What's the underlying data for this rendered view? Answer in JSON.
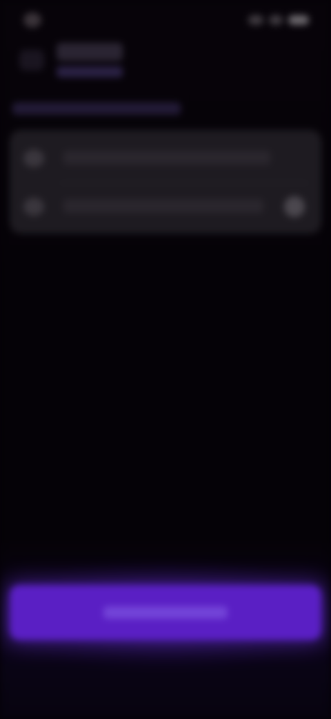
{
  "status_bar": {
    "icons": [
      "signal-icon",
      "wifi-icon",
      "battery-icon"
    ]
  },
  "header": {
    "back_icon": "back-arrow-icon",
    "title": "",
    "subtitle": ""
  },
  "section": {
    "label": ""
  },
  "card": {
    "rows": [
      {
        "icon": "avatar-icon",
        "text": "",
        "trailing": ""
      },
      {
        "icon": "item-icon",
        "text": "",
        "trailing": "chevron-icon"
      }
    ]
  },
  "cta": {
    "label": ""
  },
  "colors": {
    "background": "#050207",
    "card": "#1e1b21",
    "accent": "#5a1fc4",
    "subtitle": "#2a2144"
  }
}
